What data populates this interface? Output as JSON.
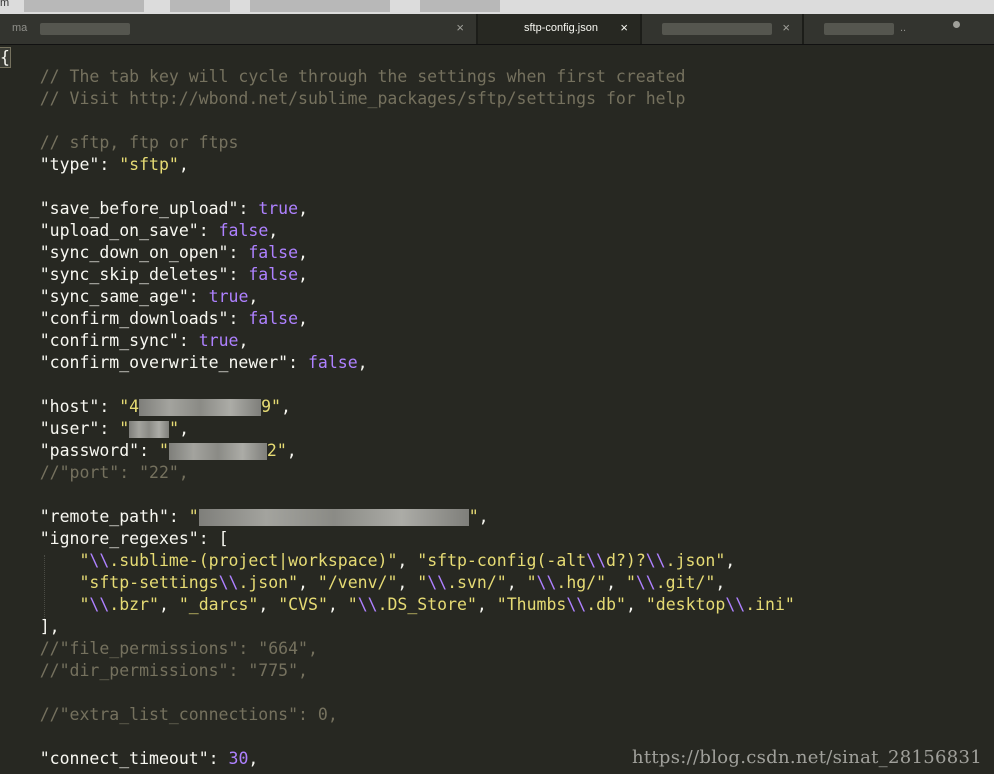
{
  "window": {
    "title_fragment": "m"
  },
  "tabs": [
    {
      "label": "ma",
      "active": false,
      "close_glyph": "×"
    },
    {
      "label": "sftp-config.json",
      "active": true,
      "close_glyph": "×"
    },
    {
      "label": "",
      "active": false,
      "close_glyph": "×"
    },
    {
      "label": "..",
      "active": false,
      "modified": true
    }
  ],
  "editor": {
    "lines": [
      "{",
      "    // The tab key will cycle through the settings when first created",
      "    // Visit http://wbond.net/sublime_packages/sftp/settings for help",
      "",
      "    // sftp, ftp or ftps",
      "    \"type\": \"sftp\",",
      "",
      "    \"save_before_upload\": true,",
      "    \"upload_on_save\": false,",
      "    \"sync_down_on_open\": false,",
      "    \"sync_skip_deletes\": false,",
      "    \"sync_same_age\": true,",
      "    \"confirm_downloads\": false,",
      "    \"confirm_sync\": true,",
      "    \"confirm_overwrite_newer\": false,",
      "",
      "    \"host\": \"4",
      "    \"user\": \"",
      "    \"password\": \"",
      "    //\"port\": \"22\",",
      "",
      "    \"remote_path\": \"",
      "    \"ignore_regexes\": [",
      "        \"\\\\.sublime-(project|workspace)\", \"sftp-config(-alt\\\\d?)?\\\\.json\",",
      "        \"sftp-settings\\\\.json\", \"/venv/\", \"\\\\.svn/\", \"\\\\.hg/\", \"\\\\.git/\",",
      "        \"\\\\.bzr\", \"_darcs\", \"CVS\", \"\\\\.DS_Store\", \"Thumbs\\\\.db\", \"desktop\\\\.ini\"",
      "    ],",
      "    //\"file_permissions\": \"664\",",
      "    //\"dir_permissions\": \"775\",",
      "",
      "    //\"extra_list_connections\": 0,",
      "",
      "    \"connect_timeout\": 30,"
    ],
    "host_tail": "9",
    "password_tail": "2"
  },
  "watermark": "https://blog.csdn.net/sinat_28156831",
  "colors": {
    "background": "#272822",
    "comment": "#75715e",
    "string": "#e6db74",
    "constant": "#ae81ff",
    "text": "#f8f8f2"
  }
}
